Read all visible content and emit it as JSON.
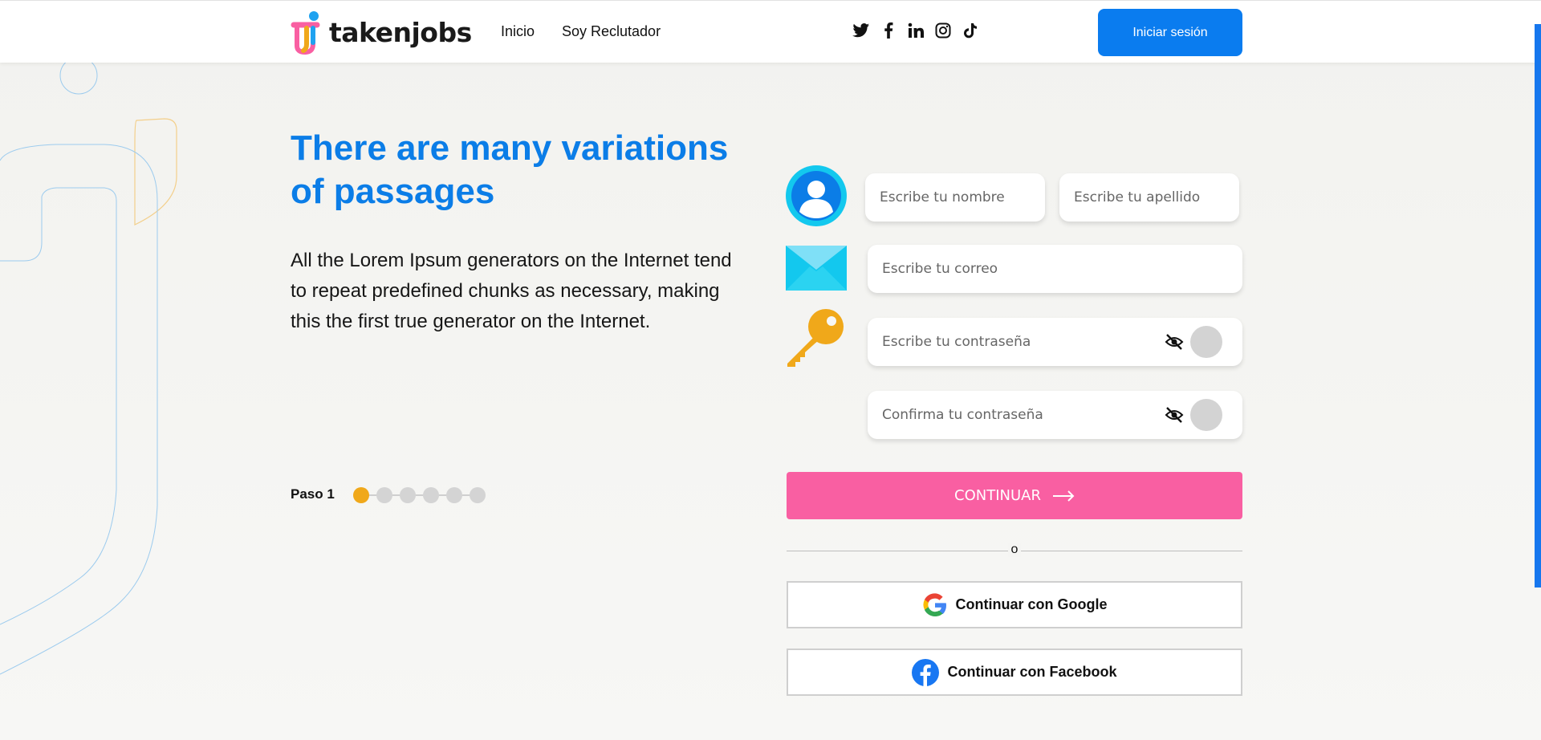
{
  "header": {
    "logo_text": "takenjobs",
    "nav": [
      "Inicio",
      "Soy Reclutador"
    ],
    "social_icons": [
      "twitter-icon",
      "facebook-icon",
      "linkedin-icon",
      "instagram-icon",
      "tiktok-icon"
    ],
    "login_label": "Iniciar sesión"
  },
  "hero": {
    "title": "There are many variations of passages",
    "text": "All the Lorem Ipsum generators on the Internet tend to repeat predefined chunks as necessary, making this the first true generator on the Internet."
  },
  "steps": {
    "label": "Paso 1",
    "total": 6,
    "current": 1
  },
  "form": {
    "first_name_placeholder": "Escribe tu nombre",
    "last_name_placeholder": "Escribe tu apellido",
    "email_placeholder": "Escribe tu correo",
    "password_placeholder": "Escribe tu contraseña",
    "confirm_password_placeholder": "Confirma tu contraseña",
    "continue_label": "CONTINUAR",
    "or_label": "o",
    "google_label": "Continuar con Google",
    "facebook_label": "Continuar con Facebook"
  },
  "colors": {
    "accent_blue": "#0a7cef",
    "pink": "#f95fa2",
    "step_active": "#f0a81a"
  }
}
